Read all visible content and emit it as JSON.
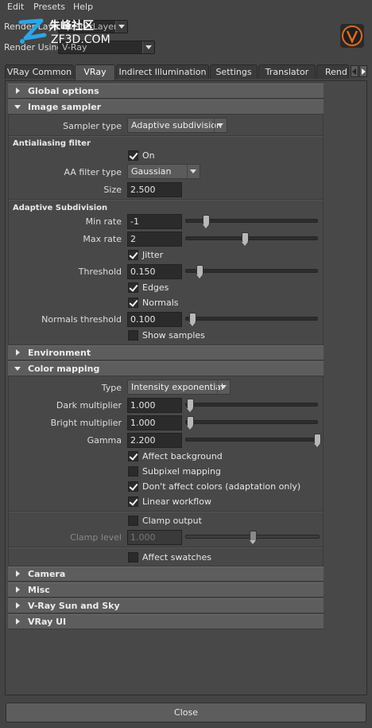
{
  "menu": [
    "Edit",
    "Presets",
    "Help"
  ],
  "watermark": {
    "cn": "朱峰社区",
    "en": "ZF3D.COM"
  },
  "render_layer": {
    "label": "Render Layer",
    "value": "masterLayer"
  },
  "render_using": {
    "label": "Render Using",
    "value": "V-Ray"
  },
  "logo_icon": "vray-logo-icon",
  "tabs": [
    "VRay Common",
    "VRay",
    "Indirect Illumination",
    "Settings",
    "Translator",
    "Rend"
  ],
  "active_tab": "VRay",
  "sections": {
    "global_options": "Global options",
    "image_sampler": "Image sampler",
    "environment": "Environment",
    "color_mapping": "Color mapping",
    "camera": "Camera",
    "misc": "Misc",
    "sun_sky": "V-Ray Sun and Sky",
    "vray_ui": "VRay UI"
  },
  "image_sampler": {
    "sampler_type_label": "Sampler type",
    "sampler_type_value": "Adaptive subdivision",
    "aa_header": "Antialiasing filter",
    "aa_on_label": "On",
    "aa_filter_type_label": "AA filter type",
    "aa_filter_type_value": "Gaussian",
    "size_label": "Size",
    "size_value": "2.500",
    "adaptive_header": "Adaptive Subdivision",
    "min_rate_label": "Min rate",
    "min_rate_value": "-1",
    "min_rate_slider": 0.15,
    "max_rate_label": "Max rate",
    "max_rate_value": "2",
    "max_rate_slider": 0.45,
    "jitter_label": "Jitter",
    "threshold_label": "Threshold",
    "threshold_value": "0.150",
    "threshold_slider": 0.1,
    "edges_label": "Edges",
    "normals_label": "Normals",
    "normals_threshold_label": "Normals threshold",
    "normals_threshold_value": "0.100",
    "normals_threshold_slider": 0.05,
    "show_samples_label": "Show samples"
  },
  "color_mapping": {
    "type_label": "Type",
    "type_value": "Intensity exponential",
    "dark_label": "Dark multiplier",
    "dark_value": "1.000",
    "dark_slider": 0.03,
    "bright_label": "Bright multiplier",
    "bright_value": "1.000",
    "bright_slider": 0.03,
    "gamma_label": "Gamma",
    "gamma_value": "2.200",
    "gamma_slider": 1.0,
    "affect_background_label": "Affect background",
    "subpixel_label": "Subpixel mapping",
    "dont_affect_label": "Don't affect colors (adaptation only)",
    "linear_workflow_label": "Linear workflow",
    "clamp_output_label": "Clamp output",
    "clamp_level_label": "Clamp level",
    "clamp_level_value": "1.000",
    "clamp_level_slider": 0.5,
    "affect_swatches_label": "Affect swatches"
  },
  "close_label": "Close"
}
